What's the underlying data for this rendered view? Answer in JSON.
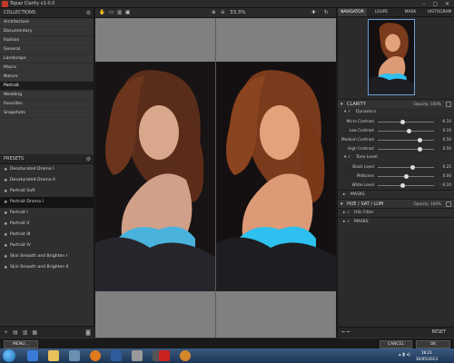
{
  "window": {
    "title": "Topaz Clarity v1.0.0"
  },
  "collections": {
    "header": "COLLECTIONS",
    "items": [
      "Architecture",
      "Documentary",
      "Fashion",
      "General",
      "Landscape",
      "Macro",
      "Nature",
      "Portrait",
      "Wedding",
      "Favorites",
      "Snapshots"
    ],
    "selected_index": 7
  },
  "presets": {
    "header": "PRESETS",
    "items": [
      "Desaturated Drama I",
      "Desaturated Drama II",
      "Portrait Soft",
      "Portrait Drama I",
      "Portrait I",
      "Portrait II",
      "Portrait III",
      "Portrait IV",
      "Skin Smooth and Brighten I",
      "Skin Smooth and Brighten II"
    ],
    "selected_index": 3
  },
  "toolbar": {
    "zoom": "33.3%"
  },
  "tabs": [
    "NAVIGATOR",
    "LOUPE",
    "MASK",
    "HISTOGRAM"
  ],
  "clarity": {
    "header": "CLARITY",
    "opacity_label": "Opacity:",
    "opacity_value": "100%",
    "dynamics": {
      "label": "Dynamics",
      "sliders": [
        {
          "label": "Micro Contrast",
          "value": "-0.10",
          "fraction": 0.45
        },
        {
          "label": "Low Contrast",
          "value": "0.10",
          "fraction": 0.55
        },
        {
          "label": "Medium Contrast",
          "value": "0.50",
          "fraction": 0.75
        },
        {
          "label": "High Contrast",
          "value": "0.50",
          "fraction": 0.75
        }
      ]
    },
    "tone_level": {
      "label": "Tone Level",
      "sliders": [
        {
          "label": "Black Level",
          "value": "0.25",
          "fraction": 0.62
        },
        {
          "label": "Midtones",
          "value": "0.00",
          "fraction": 0.5
        },
        {
          "label": "White Level",
          "value": "-0.10",
          "fraction": 0.45
        }
      ]
    },
    "masks_label": "MASKS"
  },
  "hsl": {
    "header": "HUE / SAT / LUM",
    "opacity_label": "Opacity:",
    "opacity_value": "100%",
    "filter_label": "HSL Filter",
    "masks_label": "MASKS"
  },
  "footer": {
    "reset": "RESET",
    "menu": "MENU...",
    "cancel": "CANCEL",
    "ok": "OK"
  },
  "taskbar": {
    "time": "18:21",
    "date": "30/05/2013"
  },
  "colors": {
    "accent": "#6aa0d8",
    "selected_bg": "#141414"
  }
}
